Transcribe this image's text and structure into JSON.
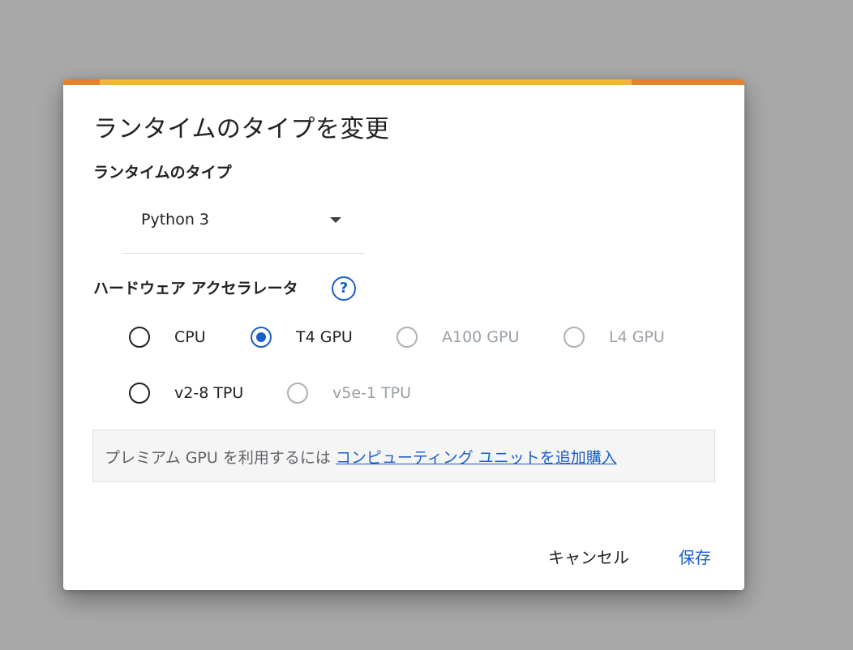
{
  "dialog": {
    "title": "ランタイムのタイプを変更",
    "loading_progress": 0.78,
    "runtime": {
      "label": "ランタイムのタイプ",
      "selected": "Python 3"
    },
    "hardware": {
      "label": "ハードウェア アクセラレータ",
      "help_icon": "?",
      "options": [
        {
          "label": "CPU",
          "state": "enabled"
        },
        {
          "label": "T4 GPU",
          "state": "selected"
        },
        {
          "label": "A100 GPU",
          "state": "disabled"
        },
        {
          "label": "L4 GPU",
          "state": "disabled"
        },
        {
          "label": "v2-8 TPU",
          "state": "enabled"
        },
        {
          "label": "v5e-1 TPU",
          "state": "disabled"
        }
      ]
    },
    "info": {
      "text": "プレミアム GPU を利用するには ",
      "link": "コンピューティング ユニットを追加購入"
    },
    "buttons": {
      "cancel": "キャンセル",
      "save": "保存"
    }
  },
  "colors": {
    "accent": "#1a5fc9",
    "progress_bar": "#f2b441",
    "progress_track": "#e3832f",
    "backdrop": "#a9a9a9"
  }
}
